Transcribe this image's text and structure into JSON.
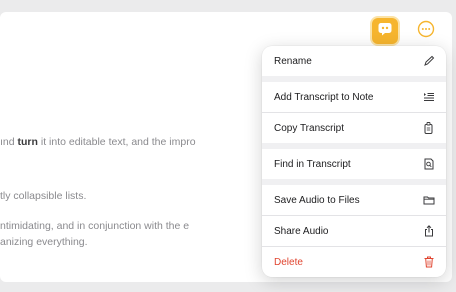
{
  "document": {
    "line1_a": "ınd ",
    "line1_bold": "turn",
    "line1_b": " it into editable text, and the impro",
    "line2": "tly collapsible lists.",
    "line3": "ntimidating, and in conjunction with the e",
    "line4": "anizing everything."
  },
  "toolbar": {
    "transcript_icon": "transcript-quote-icon",
    "more_icon": "ellipsis-circle-icon",
    "accent_color": "#f6b52e"
  },
  "menu": {
    "rename": {
      "label": "Rename",
      "icon": "pencil-icon"
    },
    "add_transcript": {
      "label": "Add Transcript to Note",
      "icon": "text-insert-icon"
    },
    "copy_transcript": {
      "label": "Copy Transcript",
      "icon": "copy-doc-icon"
    },
    "find_transcript": {
      "label": "Find in Transcript",
      "icon": "doc-search-icon"
    },
    "save_audio": {
      "label": "Save Audio to Files",
      "icon": "folder-icon"
    },
    "share_audio": {
      "label": "Share Audio",
      "icon": "share-icon"
    },
    "delete": {
      "label": "Delete",
      "icon": "trash-icon",
      "color": "#e0442f"
    }
  }
}
